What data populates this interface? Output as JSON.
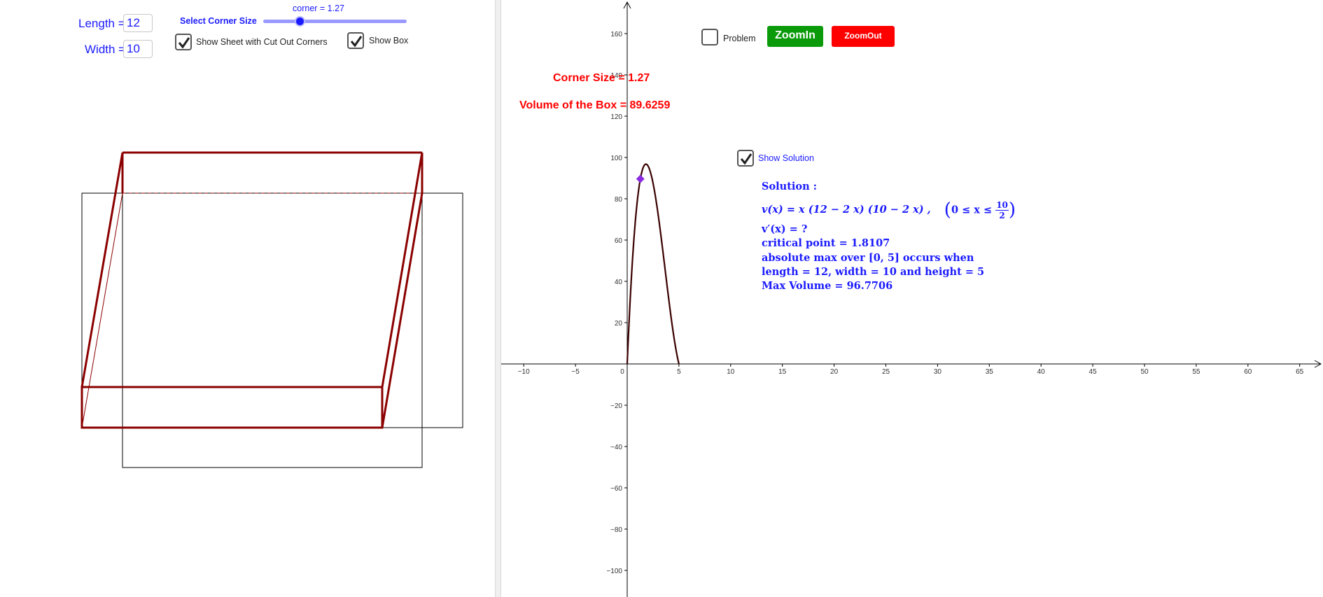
{
  "inputs": {
    "length_label": "Length =",
    "length_value": "12",
    "width_label": "Width =",
    "width_value": "10"
  },
  "slider": {
    "label": "Select Corner Size",
    "value_label": "corner = 1.27",
    "value": 1.27,
    "min": 0,
    "max": 5
  },
  "checkboxes": {
    "show_sheet": {
      "label": "Show Sheet with Cut Out Corners",
      "checked": true
    },
    "show_box": {
      "label": "Show Box",
      "checked": true
    },
    "problem": {
      "label": "Problem",
      "checked": false
    },
    "show_solution": {
      "label": "Show Solution",
      "checked": true
    }
  },
  "buttons": {
    "zoom_in": "ZoomIn",
    "zoom_out": "ZoomOut"
  },
  "readouts": {
    "corner_size": "Corner Size = 1.27",
    "volume": "Volume of the Box = 89.6259"
  },
  "solution": {
    "heading": "Solution :",
    "function_lhs": "v(x) = x  (12 − 2 x)  (10 − 2 x) ,",
    "domain_prefix": "0 ≤ x ≤",
    "domain_num": "10",
    "domain_den": "2",
    "derivative": "v′(x) = ?",
    "critical_point": "critical point = 1.8107",
    "abs_max": "absolute max over [0, 5] occurs when",
    "dimensions": "length = 12,  width = 10 and height = 5",
    "max_volume": "Max Volume = 96.7706"
  },
  "graph": {
    "x_ticks": [
      "−10",
      "−5",
      "0",
      "5",
      "10",
      "15",
      "20",
      "25",
      "30",
      "35",
      "40",
      "45",
      "50",
      "55",
      "60",
      "65"
    ],
    "y_ticks": [
      "160",
      "140",
      "120",
      "100",
      "80",
      "60",
      "40",
      "20",
      "−20",
      "−40",
      "−60",
      "−80",
      "−100"
    ],
    "curve": "v(x) = x(12 − 2x)(10 − 2x), 0 ≤ x ≤ 5",
    "point": {
      "x": 1.27,
      "y": 89.6259
    },
    "colors": {
      "curve": "#3a0000",
      "point": "#8a2be2",
      "box": "#8b0000",
      "text": "#1a1aff",
      "readout": "#ff0000"
    }
  }
}
